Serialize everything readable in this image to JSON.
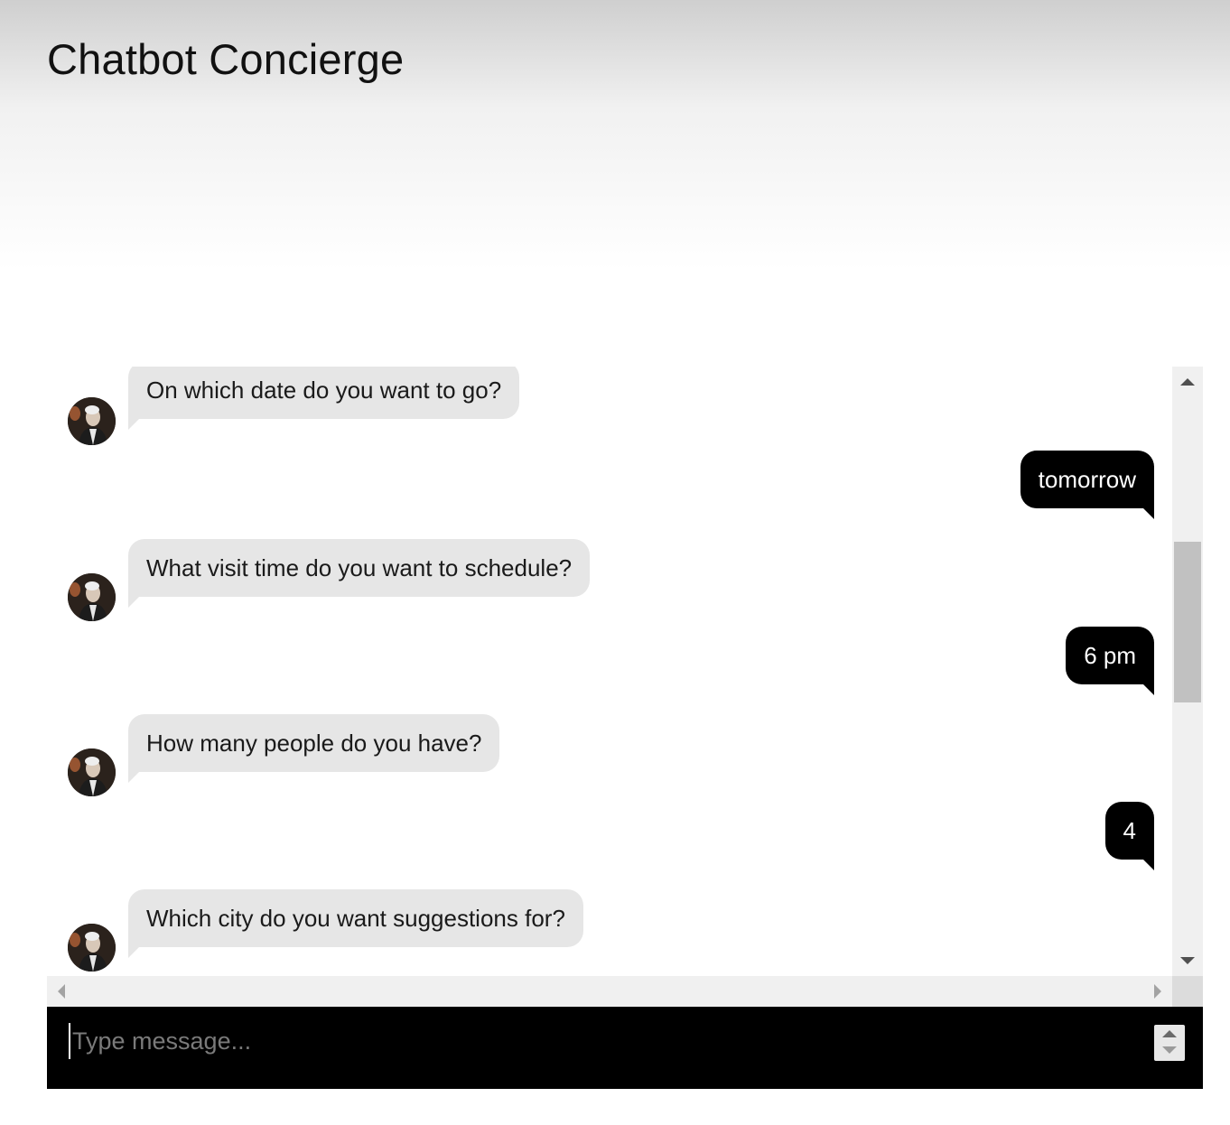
{
  "header": {
    "title": "Chatbot Concierge"
  },
  "messages": [
    {
      "sender": "bot",
      "text": "On which date do you want to go?"
    },
    {
      "sender": "user",
      "text": "tomorrow"
    },
    {
      "sender": "bot",
      "text": "What visit time do you want to schedule?"
    },
    {
      "sender": "user",
      "text": "6 pm"
    },
    {
      "sender": "bot",
      "text": "How many people do you have?"
    },
    {
      "sender": "user",
      "text": "4"
    },
    {
      "sender": "bot",
      "text": "Which city do you want suggestions for?"
    }
  ],
  "composer": {
    "value": "",
    "placeholder": "Type message..."
  },
  "colors": {
    "bot_bubble": "#e6e6e6",
    "user_bubble": "#000000",
    "input_bar": "#000000"
  },
  "icons": {
    "avatar": "bot-avatar-photo",
    "scroll_up": "triangle-up-icon",
    "scroll_down": "triangle-down-icon",
    "scroll_left": "triangle-left-icon",
    "scroll_right": "triangle-right-icon"
  }
}
